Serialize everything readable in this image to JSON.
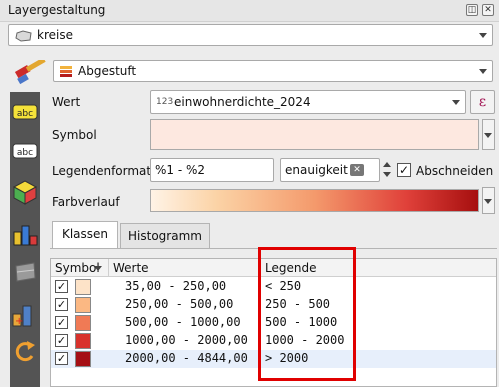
{
  "window": {
    "title": "Layergestaltung",
    "float_glyph": "◫",
    "close_glyph": "✕"
  },
  "layer_selector": {
    "value": "kreise"
  },
  "renderer_selector": {
    "value": "Abgestuft"
  },
  "value_row": {
    "label": "Wert",
    "field_type": "123",
    "field_name": "einwohnerdichte_2024",
    "expression_glyph": "ε"
  },
  "symbol_row": {
    "label": "Symbol"
  },
  "legend_format_row": {
    "label": "Legendenformat",
    "format_value": "%1 - %2",
    "precision_value": "enauigkeit (",
    "truncate_label": "Abschneiden",
    "truncate_checked": true
  },
  "color_ramp_row": {
    "label": "Farbverlauf"
  },
  "tabs": [
    {
      "label": "Klassen",
      "active": true
    },
    {
      "label": "Histogramm",
      "active": false
    }
  ],
  "table": {
    "headers": [
      "Symbol",
      "Werte",
      "Legende"
    ],
    "rows": [
      {
        "checked": true,
        "color": "#fde3c8",
        "values": "35,00 - 250,00",
        "legend": "< 250"
      },
      {
        "checked": true,
        "color": "#fbb883",
        "values": "250,00 - 500,00",
        "legend": "250 - 500"
      },
      {
        "checked": true,
        "color": "#f07a55",
        "values": "500,00 - 1000,00",
        "legend": "500 - 1000"
      },
      {
        "checked": true,
        "color": "#d8322c",
        "values": "1000,00 - 2000,00",
        "legend": "1000 - 2000"
      },
      {
        "checked": true,
        "color": "#a50f15",
        "values": "2000,00 - 4844,00",
        "legend": "> 2000"
      }
    ]
  },
  "colors": {
    "highlight_box": "#e00000"
  }
}
